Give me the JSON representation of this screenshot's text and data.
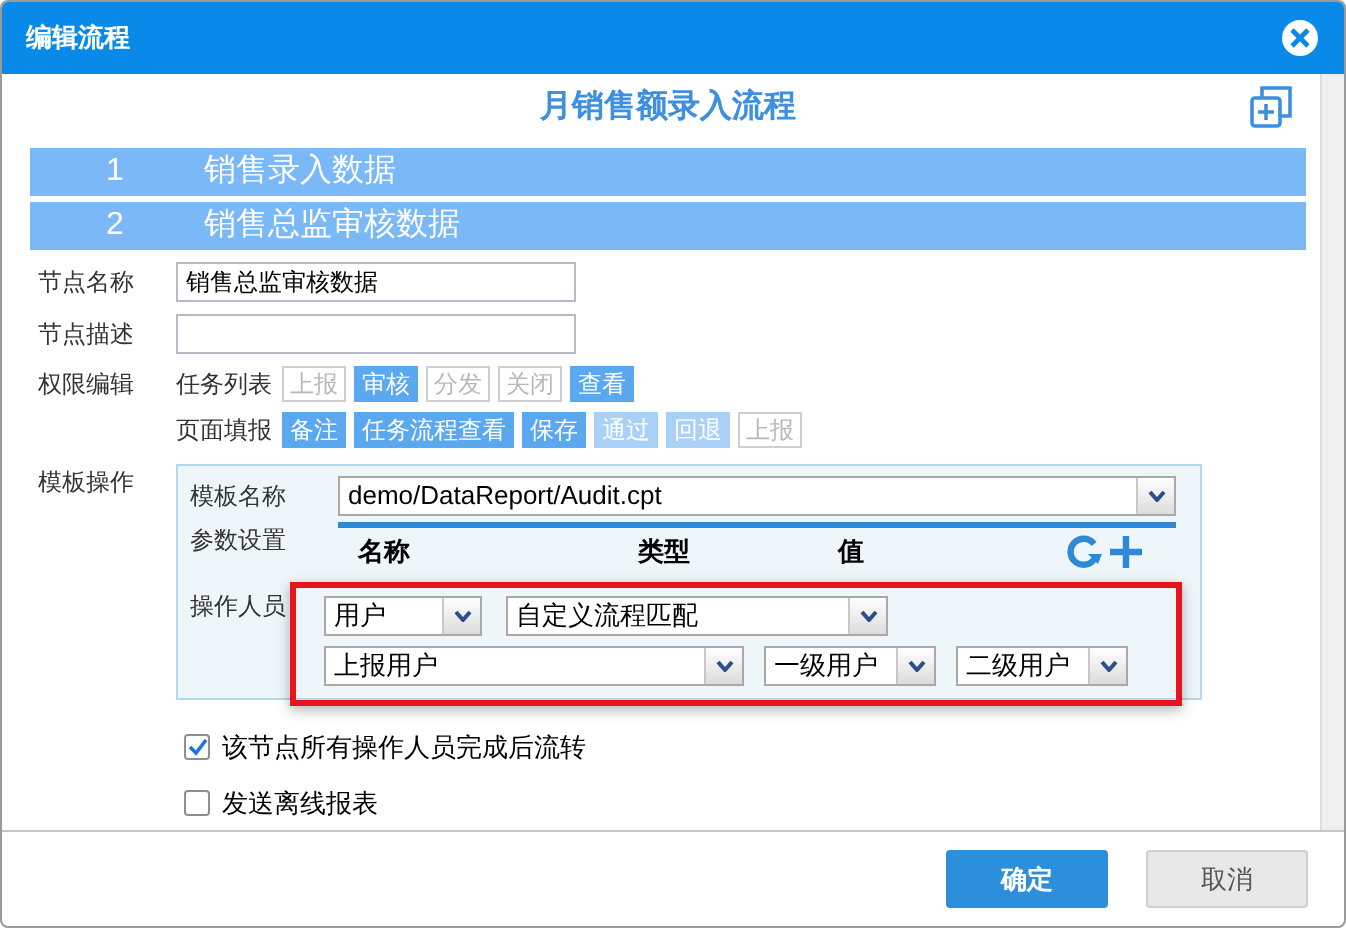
{
  "window": {
    "title": "编辑流程"
  },
  "flow_title": "月销售额录入流程",
  "steps": [
    {
      "number": "1",
      "label": "销售录入数据"
    },
    {
      "number": "2",
      "label": "销售总监审核数据"
    }
  ],
  "node_name": {
    "label": "节点名称",
    "value": "销售总监审核数据"
  },
  "node_desc": {
    "label": "节点描述"
  },
  "permissions": {
    "label": "权限编辑",
    "groups": [
      {
        "label": "任务列表",
        "buttons": [
          {
            "text": "上报",
            "kind": "off"
          },
          {
            "text": "审核",
            "kind": "on"
          },
          {
            "text": "分发",
            "kind": "off"
          },
          {
            "text": "关闭",
            "kind": "off"
          },
          {
            "text": "查看",
            "kind": "on"
          }
        ]
      },
      {
        "label": "页面填报",
        "buttons": [
          {
            "text": "备注",
            "kind": "on"
          },
          {
            "text": "任务流程查看",
            "kind": "on"
          },
          {
            "text": "保存",
            "kind": "on"
          },
          {
            "text": "通过",
            "kind": "dim"
          },
          {
            "text": "回退",
            "kind": "dim"
          },
          {
            "text": "上报",
            "kind": "off"
          }
        ]
      }
    ]
  },
  "template": {
    "label": "模板操作",
    "name_label": "模板名称",
    "name_value": "demo/DataReport/Audit.cpt",
    "params_label": "参数设置",
    "columns": [
      "名称",
      "类型",
      "值"
    ],
    "operators_label": "操作人员",
    "row1": [
      "用户",
      "自定义流程匹配"
    ],
    "row2": [
      "上报用户",
      "一级用户",
      "二级用户"
    ]
  },
  "options": [
    {
      "label": "该节点所有操作人员完成后流转",
      "checked": true
    },
    {
      "label": "发送离线报表",
      "checked": false
    }
  ],
  "buttons": [
    {
      "text": "确定",
      "kind": "primary"
    },
    {
      "text": "取消",
      "kind": "secondary"
    }
  ]
}
